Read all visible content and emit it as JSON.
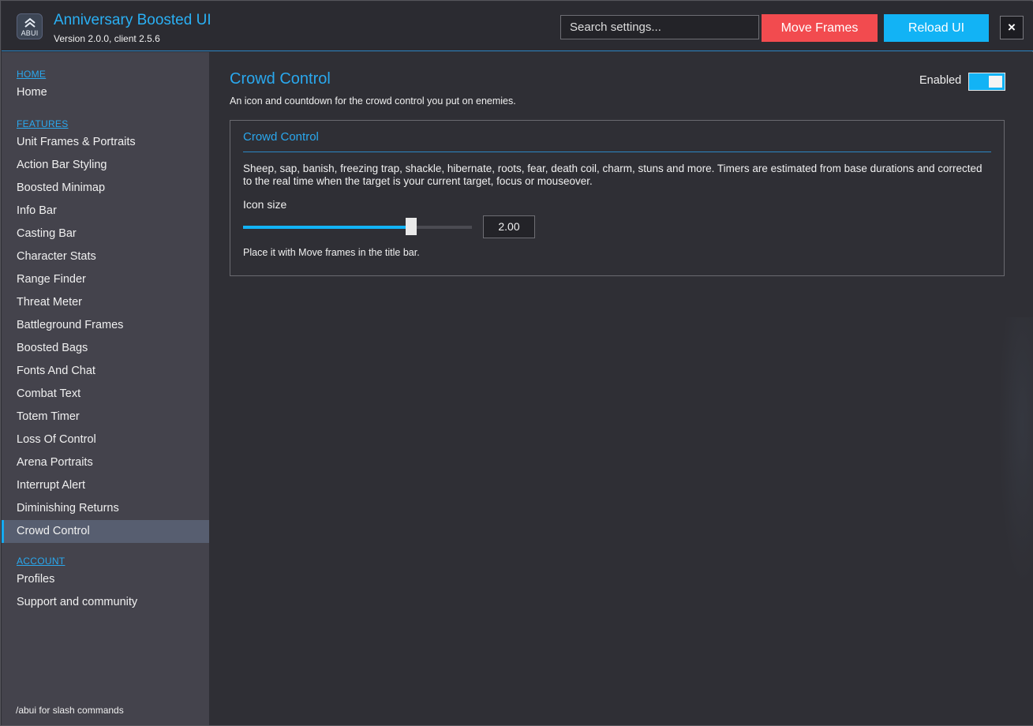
{
  "header": {
    "app_title": "Anniversary Boosted UI",
    "version": "Version 2.0.0, client 2.5.6",
    "logo_text": "ABUI",
    "search_placeholder": "Search settings...",
    "move_frames_label": "Move Frames",
    "reload_label": "Reload UI",
    "close_label": "×"
  },
  "sidebar": {
    "sections": {
      "home": "HOME",
      "features": "FEATURES",
      "account": "ACCOUNT"
    },
    "home_items": [
      "Home"
    ],
    "feature_items": [
      "Unit Frames & Portraits",
      "Action Bar Styling",
      "Boosted Minimap",
      "Info Bar",
      "Casting Bar",
      "Character Stats",
      "Range Finder",
      "Threat Meter",
      "Battleground Frames",
      "Boosted Bags",
      "Fonts And Chat",
      "Combat Text",
      "Totem Timer",
      "Loss Of Control",
      "Arena Portraits",
      "Interrupt Alert",
      "Diminishing Returns",
      "Crowd Control"
    ],
    "active_item": "Crowd Control",
    "account_items": [
      "Profiles",
      "Support and community"
    ],
    "footer_hint": "/abui for slash commands"
  },
  "main": {
    "title": "Crowd Control",
    "description": "An icon and countdown for the crowd control you put on enemies.",
    "enabled_label": "Enabled",
    "enabled": true,
    "panel": {
      "title": "Crowd Control",
      "text": "Sheep, sap, banish, freezing trap, shackle, hibernate, roots, fear, death coil, charm, stuns and more.  Timers are estimated from base durations and corrected to the real time when the target is your current target, focus or mouseover.",
      "slider_label": "Icon size",
      "slider_value": "2.00",
      "slider_fraction": 0.733,
      "hint": "Place it with Move frames in the title bar."
    }
  },
  "colors": {
    "accent": "#2aa8ee",
    "move_button": "#f24b4f",
    "reload_button": "#12b3f5"
  },
  "icons": {
    "logo": "chevron-up-logo-icon",
    "close": "close-icon"
  }
}
